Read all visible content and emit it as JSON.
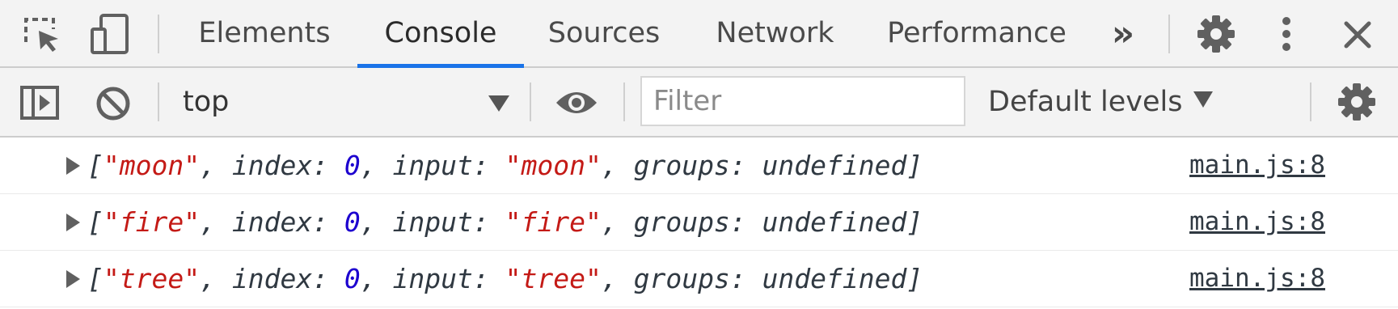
{
  "tabbar": {
    "icons": {
      "inspect": "inspect-element-icon",
      "device": "device-toolbar-icon",
      "more_tabs": "chevron-double-right-icon",
      "settings": "gear-icon",
      "menu": "kebab-menu-icon",
      "close": "close-icon"
    },
    "tabs": [
      {
        "label": "Elements",
        "active": false
      },
      {
        "label": "Console",
        "active": true
      },
      {
        "label": "Sources",
        "active": false
      },
      {
        "label": "Network",
        "active": false
      },
      {
        "label": "Performance",
        "active": false
      }
    ],
    "more_tabs_label": "»"
  },
  "toolbar": {
    "icons": {
      "sidebar": "show-sidebar-icon",
      "clear": "clear-console-icon",
      "live_expression": "eye-icon",
      "settings": "gear-icon"
    },
    "context": "top",
    "filter": {
      "value": "",
      "placeholder": "Filter"
    },
    "levels": "Default levels"
  },
  "messages": [
    {
      "match": "\"moon\"",
      "index": "0",
      "input": "\"moon\"",
      "groups": "undefined",
      "source": "main.js:8"
    },
    {
      "match": "\"fire\"",
      "index": "0",
      "input": "\"fire\"",
      "groups": "undefined",
      "source": "main.js:8"
    },
    {
      "match": "\"tree\"",
      "index": "0",
      "input": "\"tree\"",
      "groups": "undefined",
      "source": "main.js:8"
    }
  ],
  "syntax": {
    "open_bracket": "[",
    "close_bracket": "]",
    "separator": ", ",
    "index_key": "index: ",
    "input_key": "input: ",
    "groups_key": "groups: "
  },
  "colors": {
    "accent": "#1a73e8",
    "string": "#c41a16",
    "number": "#1c00cf",
    "icon": "#606060"
  }
}
